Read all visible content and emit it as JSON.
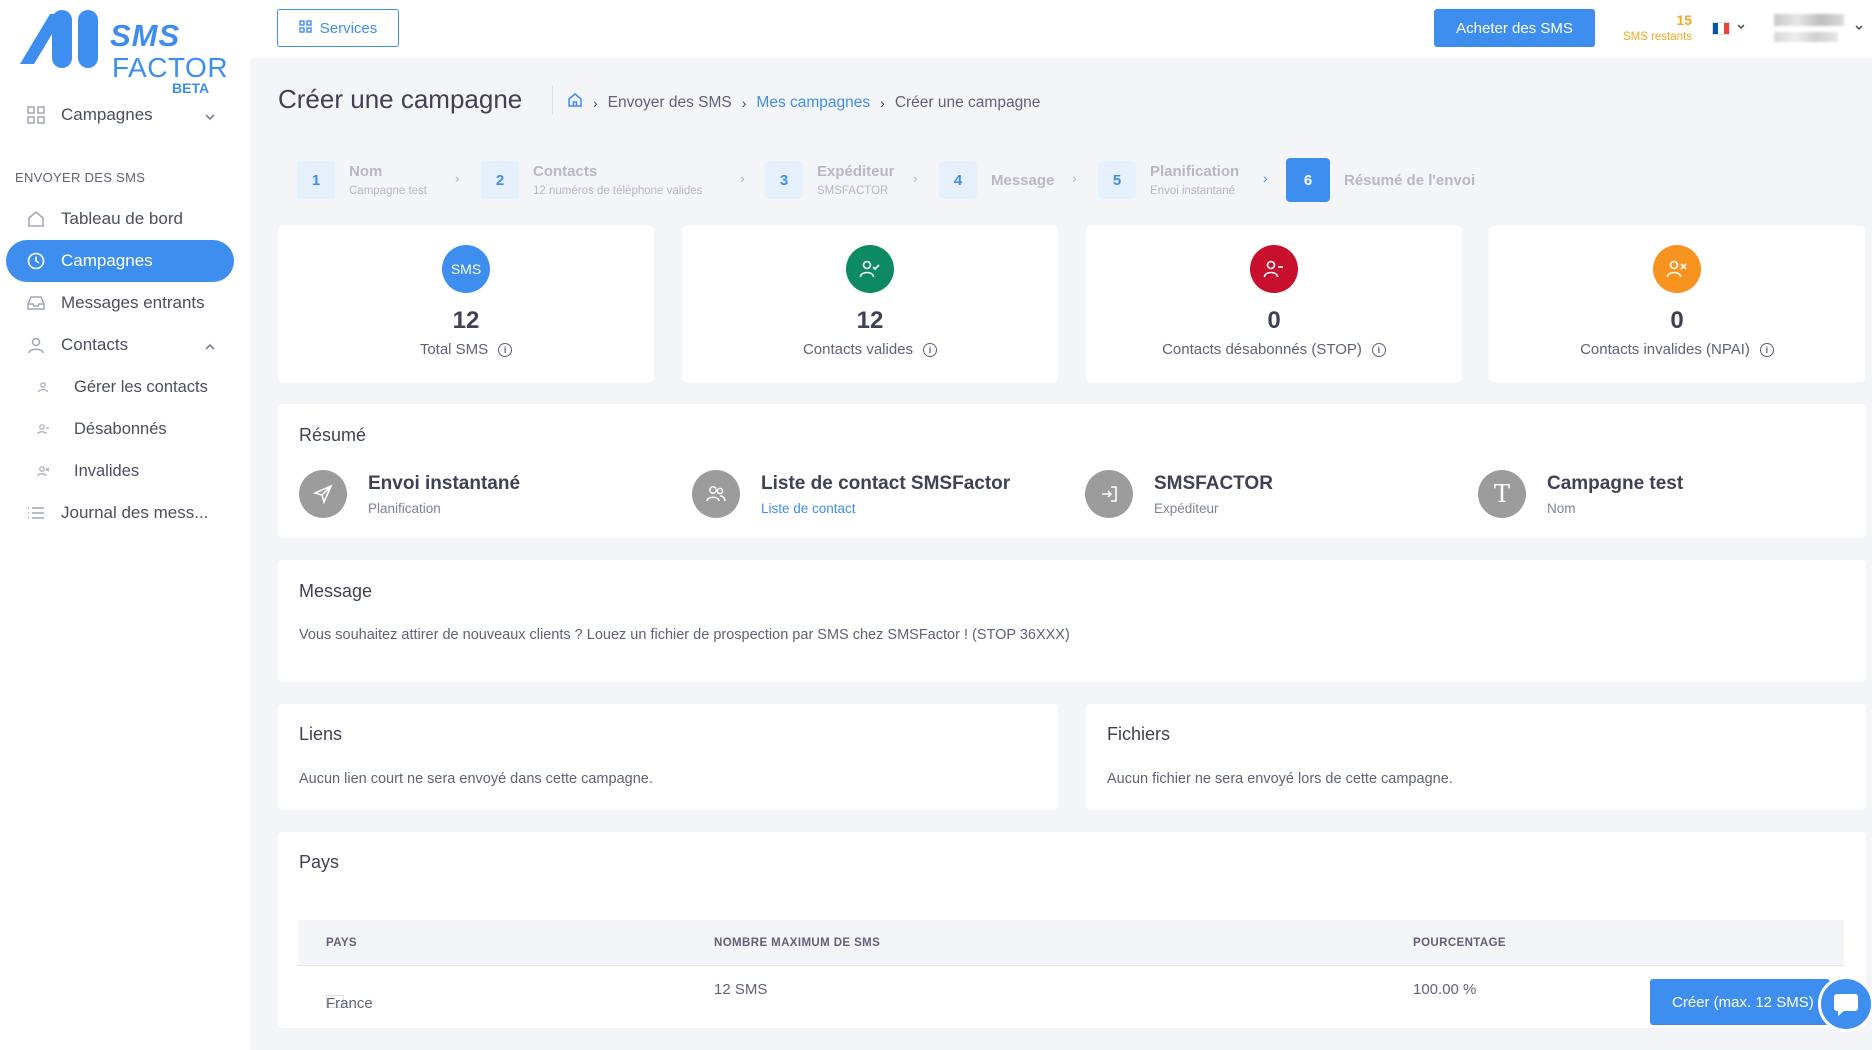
{
  "brand": {
    "line1": "SMS",
    "line2": "FACTOR",
    "tag": "BETA"
  },
  "sidebar": {
    "section_title": "ENVOYER DES SMS",
    "items": [
      {
        "label": "Campagnes",
        "icon": "grid-icon"
      },
      {
        "label": "Tableau de bord",
        "icon": "home-icon"
      },
      {
        "label": "Campagnes",
        "icon": "clock-icon",
        "active": true
      },
      {
        "label": "Messages entrants",
        "icon": "inbox-icon"
      },
      {
        "label": "Contacts",
        "icon": "user-icon"
      },
      {
        "label": "Gérer les contacts",
        "icon": "user-small-icon"
      },
      {
        "label": "Désabonnés",
        "icon": "user-minus-small-icon"
      },
      {
        "label": "Invalides",
        "icon": "user-x-small-icon"
      },
      {
        "label": "Journal des mess...",
        "icon": "list-icon"
      }
    ]
  },
  "topbar": {
    "services_label": "Services",
    "buy_label": "Acheter des SMS",
    "sms_count": "15",
    "sms_count_label": "SMS restants"
  },
  "header": {
    "title": "Créer une campagne",
    "breadcrumb": [
      "Envoyer des SMS",
      "Mes campagnes",
      "Créer une campagne"
    ]
  },
  "stepper": [
    {
      "num": "1",
      "title": "Nom",
      "sub": "Campagne test"
    },
    {
      "num": "2",
      "title": "Contacts",
      "sub": "12 numéros de téléphone valides"
    },
    {
      "num": "3",
      "title": "Expéditeur",
      "sub": "SMSFACTOR"
    },
    {
      "num": "4",
      "title": "Message",
      "sub": ""
    },
    {
      "num": "5",
      "title": "Planification",
      "sub": "Envoi instantané"
    },
    {
      "num": "6",
      "title": "Résumé de l'envoi",
      "sub": "",
      "active": true
    }
  ],
  "stats": [
    {
      "icon_text": "SMS",
      "value": "12",
      "label": "Total SMS",
      "color": "#3e8ef0"
    },
    {
      "value": "12",
      "label": "Contacts valides",
      "color": "#0d8a61"
    },
    {
      "value": "0",
      "label": "Contacts désabonnés (STOP)",
      "color": "#c8102e"
    },
    {
      "value": "0",
      "label": "Contacts invalides (NPAI)",
      "color": "#f7931e"
    }
  ],
  "summary": {
    "title": "Résumé",
    "items": [
      {
        "value": "Envoi instantané",
        "label": "Planification"
      },
      {
        "value": "Liste de contact SMSFactor",
        "label": "Liste de contact"
      },
      {
        "value": "SMSFACTOR",
        "label": "Expéditeur"
      },
      {
        "value": "Campagne test",
        "label": "Nom",
        "icon_letter": "T"
      }
    ]
  },
  "message": {
    "title": "Message",
    "text": "Vous souhaitez attirer de nouveaux clients ? Louez un fichier de prospection par SMS chez SMSFactor ! (STOP 36XXX)"
  },
  "links": {
    "title": "Liens",
    "text": "Aucun lien court ne sera envoyé dans cette campagne."
  },
  "files": {
    "title": "Fichiers",
    "text": "Aucun fichier ne sera envoyé lors de cette campagne."
  },
  "countries": {
    "title": "Pays",
    "columns": [
      "PAYS",
      "NOMBRE MAXIMUM DE SMS",
      "POURCENTAGE"
    ],
    "rows": [
      {
        "country": "France",
        "max_sms": "12 SMS",
        "percent": "100.00 %"
      }
    ]
  },
  "create_button": "Créer (max. 12 SMS)",
  "colors": {
    "accent": "#3e8ef0",
    "warning": "#f5a623"
  }
}
